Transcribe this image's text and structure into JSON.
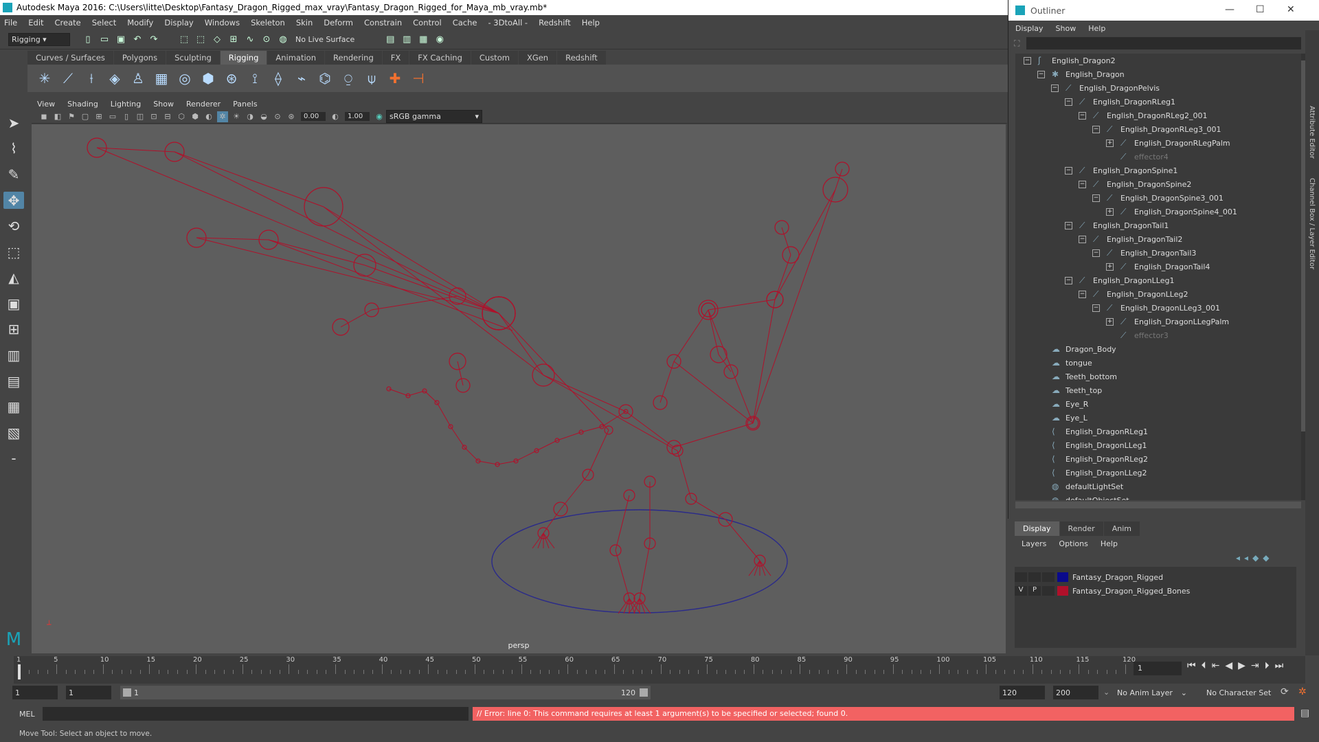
{
  "window": {
    "title": "Autodesk Maya 2016: C:\\Users\\litte\\Desktop\\Fantasy_Dragon_Rigged_max_vray\\Fantasy_Dragon_Rigged_for_Maya_mb_vray.mb*"
  },
  "menus": [
    "File",
    "Edit",
    "Create",
    "Select",
    "Modify",
    "Display",
    "Windows",
    "Skeleton",
    "Skin",
    "Deform",
    "Constrain",
    "Control",
    "Cache",
    "- 3DtoAll -",
    "Redshift",
    "Help"
  ],
  "status": {
    "mode": "Rigging",
    "live_surface": "No Live Surface"
  },
  "shelf_tabs": [
    "Curves / Surfaces",
    "Polygons",
    "Sculpting",
    "Rigging",
    "Animation",
    "Rendering",
    "FX",
    "FX Caching",
    "Custom",
    "XGen",
    "Redshift"
  ],
  "shelf_active": "Rigging",
  "viewport": {
    "menus": [
      "View",
      "Shading",
      "Lighting",
      "Show",
      "Renderer",
      "Panels"
    ],
    "near_value": "0.00",
    "far_value": "1.00",
    "color_space": "sRGB gamma",
    "camera": "persp"
  },
  "outliner": {
    "title": "Outliner",
    "menus": [
      "Display",
      "Show",
      "Help"
    ],
    "nodes": [
      {
        "label": "English_Dragon2",
        "depth": 0,
        "exp": "−",
        "icon": "curve-icon"
      },
      {
        "label": "English_Dragon",
        "depth": 1,
        "exp": "−",
        "icon": "star-icon"
      },
      {
        "label": "English_DragonPelvis",
        "depth": 2,
        "exp": "−",
        "icon": "joint-icon"
      },
      {
        "label": "English_DragonRLeg1",
        "depth": 3,
        "exp": "−",
        "icon": "joint-icon"
      },
      {
        "label": "English_DragonRLeg2_001",
        "depth": 4,
        "exp": "−",
        "icon": "joint-icon"
      },
      {
        "label": "English_DragonRLeg3_001",
        "depth": 5,
        "exp": "−",
        "icon": "joint-icon"
      },
      {
        "label": "English_DragonRLegPalm",
        "depth": 6,
        "exp": "+",
        "icon": "joint-icon"
      },
      {
        "label": "effector4",
        "depth": 6,
        "exp": "",
        "icon": "effector-icon",
        "dim": true
      },
      {
        "label": "English_DragonSpine1",
        "depth": 3,
        "exp": "−",
        "icon": "joint-icon"
      },
      {
        "label": "English_DragonSpine2",
        "depth": 4,
        "exp": "−",
        "icon": "joint-icon"
      },
      {
        "label": "English_DragonSpine3_001",
        "depth": 5,
        "exp": "−",
        "icon": "joint-icon"
      },
      {
        "label": "English_DragonSpine4_001",
        "depth": 6,
        "exp": "+",
        "icon": "joint-icon"
      },
      {
        "label": "English_DragonTail1",
        "depth": 3,
        "exp": "−",
        "icon": "joint-icon"
      },
      {
        "label": "English_DragonTail2",
        "depth": 4,
        "exp": "−",
        "icon": "joint-icon"
      },
      {
        "label": "English_DragonTail3",
        "depth": 5,
        "exp": "−",
        "icon": "joint-icon"
      },
      {
        "label": "English_DragonTail4",
        "depth": 6,
        "exp": "+",
        "icon": "joint-icon"
      },
      {
        "label": "English_DragonLLeg1",
        "depth": 3,
        "exp": "−",
        "icon": "joint-icon"
      },
      {
        "label": "English_DragonLLeg2",
        "depth": 4,
        "exp": "−",
        "icon": "joint-icon"
      },
      {
        "label": "English_DragonLLeg3_001",
        "depth": 5,
        "exp": "−",
        "icon": "joint-icon"
      },
      {
        "label": "English_DragonLLegPalm",
        "depth": 6,
        "exp": "+",
        "icon": "joint-icon"
      },
      {
        "label": "effector3",
        "depth": 6,
        "exp": "",
        "icon": "effector-icon",
        "dim": true
      },
      {
        "label": "Dragon_Body",
        "depth": 1,
        "exp": "",
        "icon": "mesh-icon"
      },
      {
        "label": "tongue",
        "depth": 1,
        "exp": "",
        "icon": "mesh-icon"
      },
      {
        "label": "Teeth_bottom",
        "depth": 1,
        "exp": "",
        "icon": "mesh-icon"
      },
      {
        "label": "Teeth_top",
        "depth": 1,
        "exp": "",
        "icon": "mesh-icon"
      },
      {
        "label": "Eye_R",
        "depth": 1,
        "exp": "",
        "icon": "mesh-icon"
      },
      {
        "label": "Eye_L",
        "depth": 1,
        "exp": "",
        "icon": "mesh-icon"
      },
      {
        "label": "English_DragonRLeg1",
        "depth": 1,
        "exp": "",
        "icon": "ik-icon"
      },
      {
        "label": "English_DragonLLeg1",
        "depth": 1,
        "exp": "",
        "icon": "ik-icon"
      },
      {
        "label": "English_DragonRLeg2",
        "depth": 1,
        "exp": "",
        "icon": "ik-icon"
      },
      {
        "label": "English_DragonLLeg2",
        "depth": 1,
        "exp": "",
        "icon": "ik-icon"
      },
      {
        "label": "defaultLightSet",
        "depth": 1,
        "exp": "",
        "icon": "set-icon"
      },
      {
        "label": "defaultObjectSet",
        "depth": 1,
        "exp": "",
        "icon": "set-icon"
      }
    ]
  },
  "side_tabs": [
    "Attribute Editor",
    "Channel Box / Layer Editor"
  ],
  "layer_editor": {
    "tabs": [
      "Display",
      "Render",
      "Anim"
    ],
    "active": "Display",
    "menus": [
      "Layers",
      "Options",
      "Help"
    ],
    "layers": [
      {
        "v": "",
        "p": "",
        "name": "Fantasy_Dragon_Rigged",
        "color": "#0a0a8c"
      },
      {
        "v": "V",
        "p": "P",
        "name": "Fantasy_Dragon_Rigged_Bones",
        "color": "#b0102a"
      }
    ]
  },
  "timeline": {
    "ticks": [
      1,
      5,
      10,
      15,
      20,
      25,
      30,
      35,
      40,
      45,
      50,
      55,
      60,
      65,
      70,
      75,
      80,
      85,
      90,
      95,
      100,
      105,
      110,
      115,
      120
    ],
    "current_frame": "1"
  },
  "range": {
    "start": "1",
    "playback_start": "1",
    "slider_start": "1",
    "slider_end": "120",
    "playback_end": "120",
    "end": "200",
    "anim_layer": "No Anim Layer",
    "character_set": "No Character Set"
  },
  "command": {
    "lang": "MEL",
    "error": "// Error: line 0: This command requires at least 1 argument(s) to be specified or selected;  found 0."
  },
  "help_line": "Move Tool: Select an object to move.",
  "colors": {
    "bones": "#b0102a",
    "error_bg": "#f26262",
    "accent": "#5285a6"
  }
}
